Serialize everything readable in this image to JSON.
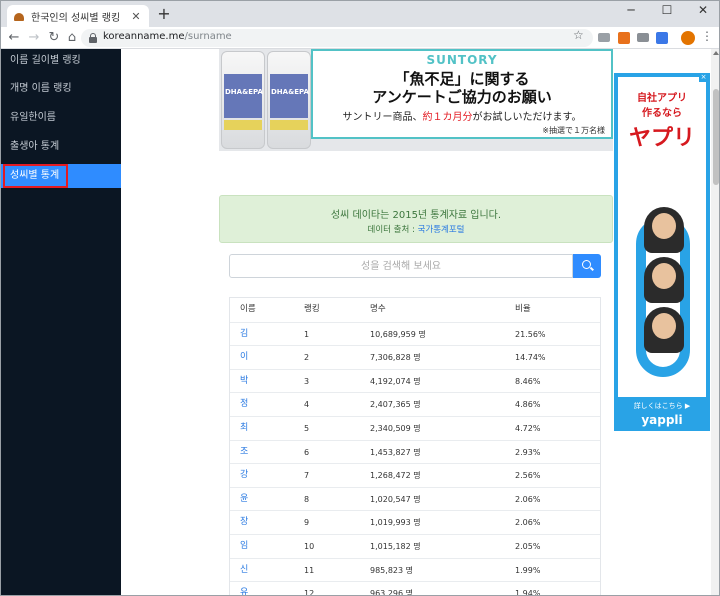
{
  "browser": {
    "tab_title": "한국인의 성씨별 랭킹",
    "new_tab": "+",
    "url_host": "koreanname.me",
    "url_path": "/surname",
    "win_min": "─",
    "win_max": "☐",
    "win_close": "✕"
  },
  "sidebar": {
    "items": [
      {
        "label": "이름 길이별 랭킹"
      },
      {
        "label": "개명 이름 랭킹"
      },
      {
        "label": "유일한이름"
      },
      {
        "label": "출생아 통계"
      },
      {
        "label": "성씨별 통계"
      }
    ],
    "active_index": 4
  },
  "banner_ad": {
    "brand": "SUNTORY",
    "headline1": "「魚不足」に関する",
    "headline2": "アンケートご協力のお願い",
    "sub_pre": "サントリー商品、",
    "sub_hl": "約１カ月分",
    "sub_post": "がお試しいただけます。",
    "note": "※抽選で１万名様",
    "bottle_label": "DHA&EPA"
  },
  "notice": {
    "line1": "성씨 데이타는 2015년 통계자료 입니다.",
    "source_label": "데이터 출처 :",
    "source_link": "국가통계포털"
  },
  "search": {
    "placeholder": "성을 검색해 보세요"
  },
  "table": {
    "headers": [
      "이름",
      "랭킹",
      "명수",
      "비율"
    ],
    "rows": [
      {
        "name": "김",
        "rank": "1",
        "count": "10,689,959 명",
        "ratio": "21.56%"
      },
      {
        "name": "이",
        "rank": "2",
        "count": "7,306,828 명",
        "ratio": "14.74%"
      },
      {
        "name": "박",
        "rank": "3",
        "count": "4,192,074 명",
        "ratio": "8.46%"
      },
      {
        "name": "정",
        "rank": "4",
        "count": "2,407,365 명",
        "ratio": "4.86%"
      },
      {
        "name": "최",
        "rank": "5",
        "count": "2,340,509 명",
        "ratio": "4.72%"
      },
      {
        "name": "조",
        "rank": "6",
        "count": "1,453,827 명",
        "ratio": "2.93%"
      },
      {
        "name": "강",
        "rank": "7",
        "count": "1,268,472 명",
        "ratio": "2.56%"
      },
      {
        "name": "윤",
        "rank": "8",
        "count": "1,020,547 명",
        "ratio": "2.06%"
      },
      {
        "name": "장",
        "rank": "9",
        "count": "1,019,993 명",
        "ratio": "2.06%"
      },
      {
        "name": "임",
        "rank": "10",
        "count": "1,015,182 명",
        "ratio": "2.05%"
      },
      {
        "name": "신",
        "rank": "11",
        "count": "985,823 명",
        "ratio": "1.99%"
      },
      {
        "name": "유",
        "rank": "12",
        "count": "963,296 명",
        "ratio": "1.94%"
      }
    ]
  },
  "side_ad": {
    "line1a": "自社アプリ",
    "line1b": "作るなら",
    "big": "ヤプリ",
    "foot1": "詳しくはこちら ▶",
    "brand": "yappli"
  },
  "colors": {
    "sidebar_bg": "#0b1623",
    "active": "#2f8cff",
    "link": "#2a7ae2",
    "highlight": "#e31b23"
  }
}
